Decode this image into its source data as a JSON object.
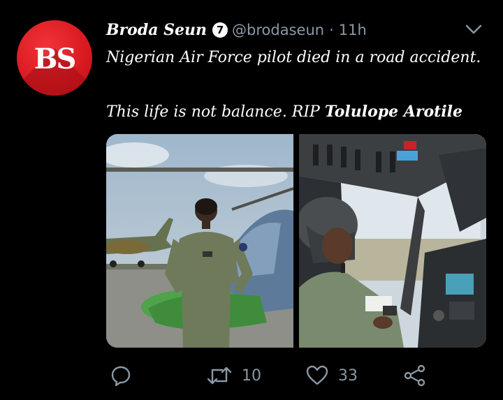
{
  "tweet": {
    "author_name": "Broda Seun",
    "verified_badge": "7",
    "handle": "@brodaseun",
    "separator": "·",
    "time": "11h",
    "avatar_text": "BS",
    "text_line1": "Nigerian Air Force pilot  died in a road accident.",
    "text_line2_prefix": "This life is not balance. RIP ",
    "text_line2_bold": "Tolulope Arotile"
  },
  "actions": {
    "reply_count": "",
    "retweet_count": "10",
    "like_count": "33"
  },
  "icons": {
    "reply": "reply-icon",
    "retweet": "retweet-icon",
    "like": "heart-icon",
    "share": "share-icon",
    "menu": "chevron-down-icon"
  },
  "colors": {
    "background": "#000000",
    "text": "#ffffff",
    "muted": "#8b98a5",
    "avatar_red": "#d81920"
  }
}
